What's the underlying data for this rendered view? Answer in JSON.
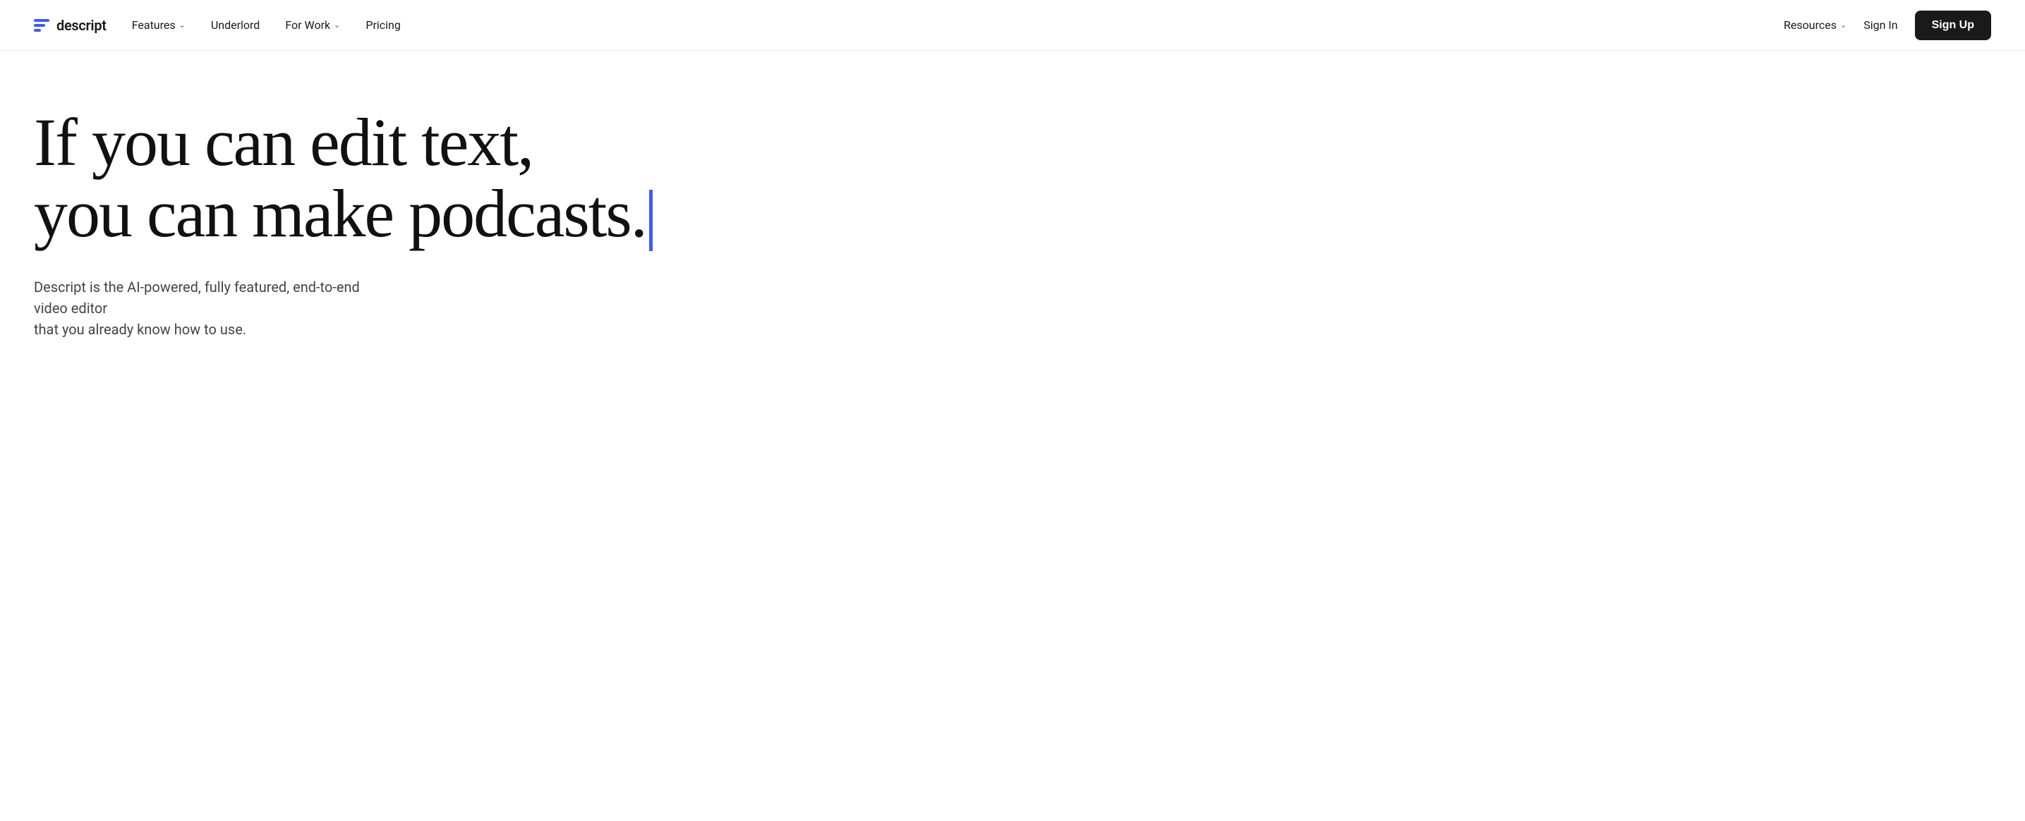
{
  "nav": {
    "logo": {
      "text": "descript"
    },
    "items": [
      {
        "id": "features",
        "label": "Features",
        "hasDropdown": true
      },
      {
        "id": "underlord",
        "label": "Underlord",
        "hasDropdown": false
      },
      {
        "id": "for-work",
        "label": "For Work",
        "hasDropdown": true
      },
      {
        "id": "pricing",
        "label": "Pricing",
        "hasDropdown": false
      }
    ],
    "rightItems": [
      {
        "id": "resources",
        "label": "Resources",
        "hasDropdown": true
      },
      {
        "id": "sign-in",
        "label": "Sign In",
        "hasDropdown": false
      }
    ],
    "signUp": "Sign Up"
  },
  "hero": {
    "headline_line1": "If you can edit text,",
    "headline_line2": "you can make podcasts.",
    "subtext_line1": "Descript is the AI-powered, fully featured, end-to-end video editor",
    "subtext_line2": "that you already know how to use."
  }
}
